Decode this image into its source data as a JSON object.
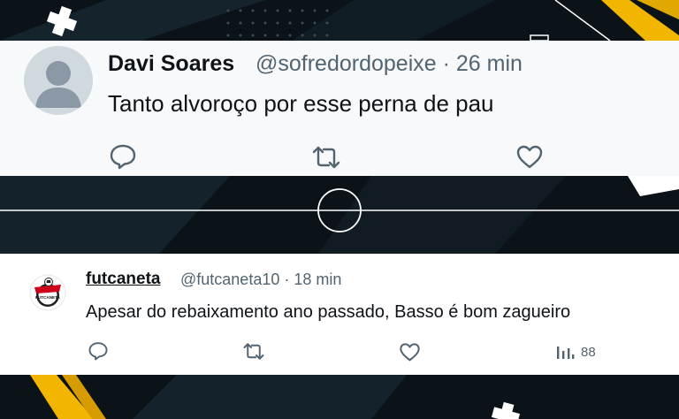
{
  "background": {
    "base_color": "#0b1218",
    "stripe_color": "#14232c",
    "accent_yellow": "#f2b600",
    "accent_white": "#ffffff"
  },
  "tweets": [
    {
      "display_name": "Davi Soares",
      "meta": "@sofredordopeixe · 26 min",
      "text": "Tanto alvoroço por esse perna de pau",
      "avatar": "default-user-avatar",
      "actions": [
        {
          "icon": "reply-icon"
        },
        {
          "icon": "retweet-icon"
        },
        {
          "icon": "like-icon"
        }
      ]
    },
    {
      "display_name": "futcaneta",
      "meta": "@futcaneta10 · 18 min",
      "text": "Apesar do rebaixamento ano passado, Basso é bom zagueiro",
      "avatar": "futcaneta-logo",
      "avatar_text": "FUTCANETA",
      "actions": [
        {
          "icon": "reply-icon"
        },
        {
          "icon": "retweet-icon"
        },
        {
          "icon": "like-icon"
        },
        {
          "icon": "views-icon",
          "count": "88"
        }
      ]
    }
  ],
  "colors": {
    "name": "#0f1419",
    "secondary_text": "#536471",
    "card_bg": "#ffffff",
    "avatar_placeholder": "#cfd9de"
  }
}
